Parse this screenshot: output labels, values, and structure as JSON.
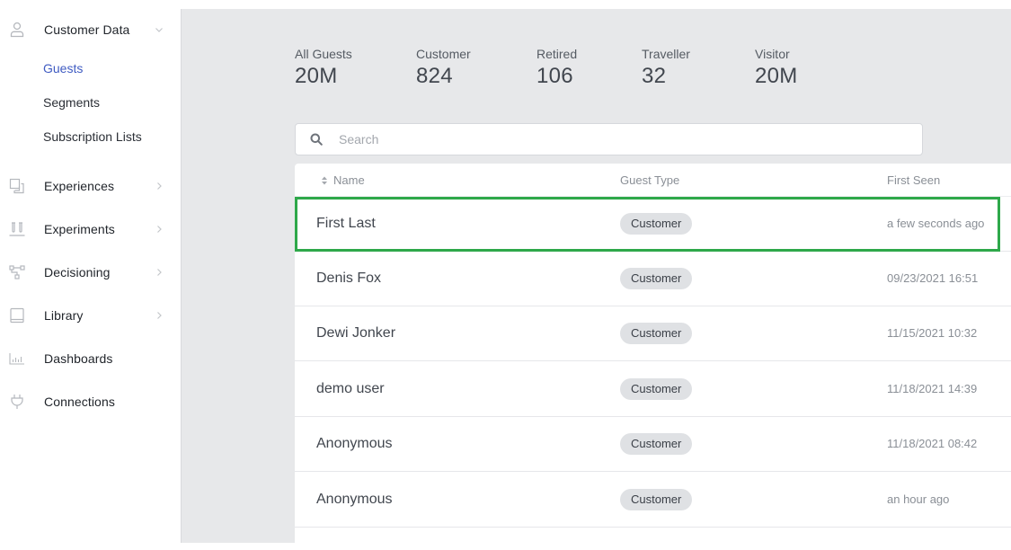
{
  "sidebar": {
    "customer_data": {
      "label": "Customer Data",
      "icon": "user-icon",
      "expanded": true
    },
    "sub_items": [
      {
        "label": "Guests",
        "active": true
      },
      {
        "label": "Segments",
        "active": false
      },
      {
        "label": "Subscription Lists",
        "active": false
      }
    ],
    "items": [
      {
        "label": "Experiences",
        "icon": "experiences-icon",
        "has_chevron": true
      },
      {
        "label": "Experiments",
        "icon": "experiments-icon",
        "has_chevron": true
      },
      {
        "label": "Decisioning",
        "icon": "decisioning-icon",
        "has_chevron": true
      },
      {
        "label": "Library",
        "icon": "library-icon",
        "has_chevron": true
      },
      {
        "label": "Dashboards",
        "icon": "dashboards-icon",
        "has_chevron": false
      },
      {
        "label": "Connections",
        "icon": "connections-icon",
        "has_chevron": false
      }
    ]
  },
  "stats": [
    {
      "label": "All Guests",
      "value": "20M"
    },
    {
      "label": "Customer",
      "value": "824"
    },
    {
      "label": "Retired",
      "value": "106"
    },
    {
      "label": "Traveller",
      "value": "32"
    },
    {
      "label": "Visitor",
      "value": "20M"
    }
  ],
  "search": {
    "placeholder": "Search",
    "value": ""
  },
  "table": {
    "columns": [
      "Name",
      "Guest Type",
      "First Seen"
    ],
    "rows": [
      {
        "name": "First Last",
        "guest_type": "Customer",
        "first_seen": "a few seconds ago",
        "highlighted": true
      },
      {
        "name": "Denis Fox",
        "guest_type": "Customer",
        "first_seen": "09/23/2021 16:51"
      },
      {
        "name": "Dewi Jonker",
        "guest_type": "Customer",
        "first_seen": "11/15/2021 10:32"
      },
      {
        "name": "demo user",
        "guest_type": "Customer",
        "first_seen": "11/18/2021 14:39"
      },
      {
        "name": "Anonymous",
        "guest_type": "Customer",
        "first_seen": "11/18/2021 08:42"
      },
      {
        "name": "Anonymous",
        "guest_type": "Customer",
        "first_seen": "an hour ago"
      }
    ]
  },
  "colors": {
    "accent": "#3f5bc2",
    "highlight": "#2ea84a",
    "badge_bg": "#dfe1e4",
    "main_bg": "#e7e8ea"
  }
}
